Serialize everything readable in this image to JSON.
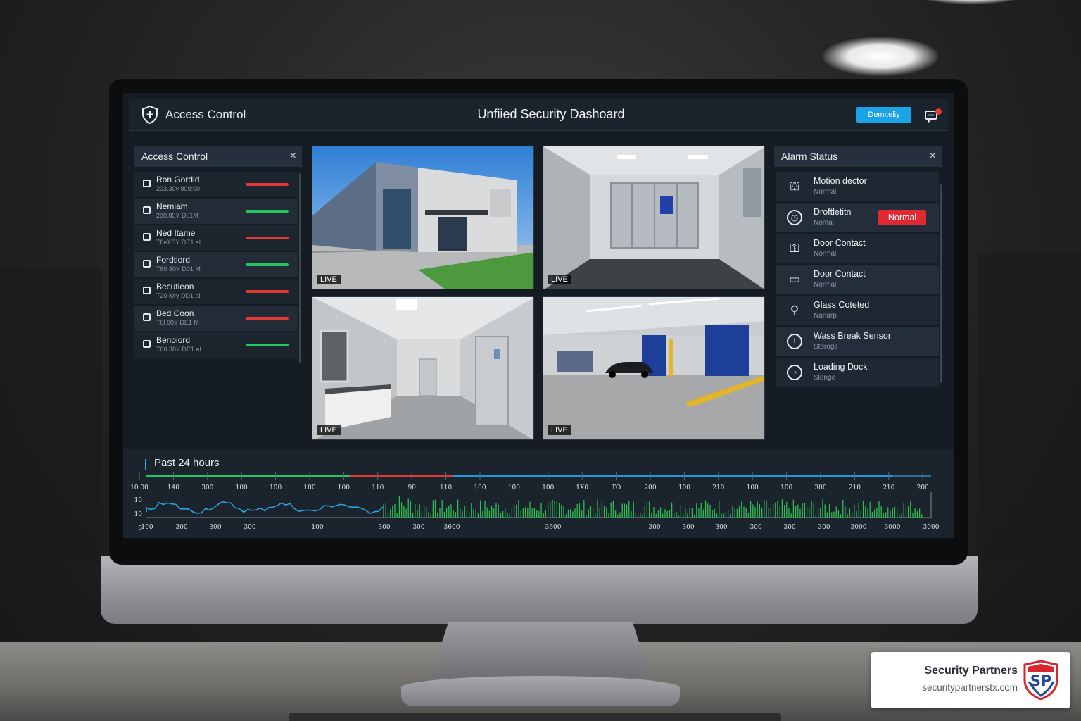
{
  "header": {
    "app_title": "Access Control",
    "dashboard_title": "Unfiied Security Dashoard",
    "button_label": "Demiteliy"
  },
  "access_panel": {
    "title": "Access Control",
    "close": "×",
    "items": [
      {
        "name": "Ron Gordid",
        "sub": "203.30y 800:00",
        "status_color": "#e53935"
      },
      {
        "name": "Nemiam",
        "sub": "280.85Y D01M",
        "status_color": "#22c55e"
      },
      {
        "name": "Ned Itame",
        "sub": "T8eXSY DE1 al",
        "status_color": "#e53935"
      },
      {
        "name": "Fordtiord",
        "sub": "T80 80Y D01 M",
        "status_color": "#22c55e"
      },
      {
        "name": "Becutieon",
        "sub": "T20 l0ry DD1 al",
        "status_color": "#e53935"
      },
      {
        "name": "Bed Coon",
        "sub": "T0l 80Y DE1 M",
        "status_color": "#e53935"
      },
      {
        "name": "Benoiord",
        "sub": "T00.38Y DE1 al",
        "status_color": "#22c55e"
      }
    ]
  },
  "cameras": [
    {
      "label": "LIVE",
      "scene": "building-exterior"
    },
    {
      "label": "LIVE",
      "scene": "corridor-entrance"
    },
    {
      "label": "LIVE",
      "scene": "hallway"
    },
    {
      "label": "LIVE",
      "scene": "loading-dock"
    }
  ],
  "alarm_panel": {
    "title": "Alarm Status",
    "close": "×",
    "items": [
      {
        "name": "Motion dector",
        "sub": "Normal",
        "icon": "motion-sensor-icon",
        "glyph": "⛫"
      },
      {
        "name": "Droftletitn",
        "sub": "Nomal",
        "icon": "clock-icon",
        "glyph": "◷",
        "badge": "Normal"
      },
      {
        "name": "Door Contact",
        "sub": "Normal",
        "icon": "door-contact-icon",
        "glyph": "⚿"
      },
      {
        "name": "Door Contact",
        "sub": "Normal",
        "icon": "monitor-icon",
        "glyph": "▭"
      },
      {
        "name": "Glass Coteted",
        "sub": "Nanarp",
        "icon": "glass-break-icon",
        "glyph": "⚲"
      },
      {
        "name": "Wass Break Sensor",
        "sub": "Storogs",
        "icon": "alert-circle-icon",
        "glyph": "!"
      },
      {
        "name": "Loading Dock",
        "sub": "Slonge",
        "icon": "clock-icon",
        "glyph": "◔"
      }
    ],
    "colors": {
      "badge": "#e02a33"
    }
  },
  "timeline": {
    "title": "Past 24 hours",
    "y_labels": [
      "10",
      "10",
      "0"
    ],
    "top_ticks": [
      "10 00",
      "140",
      "300",
      "100",
      "100",
      "100",
      "100",
      "110",
      "90",
      "110",
      "100",
      "100",
      "100",
      "1X0",
      "TO",
      "200",
      "100",
      "210",
      "100",
      "100",
      "300",
      "210",
      "210",
      "200"
    ],
    "bottom_ticks": [
      "100",
      "300",
      "300",
      "300",
      "100",
      "300",
      "300",
      "3600",
      "3600",
      "300",
      "300",
      "300",
      "300",
      "300",
      "300",
      "3000",
      "3000",
      "3000"
    ],
    "status_segments": [
      {
        "from": 0.0,
        "to": 0.26,
        "color": "#22c55e"
      },
      {
        "from": 0.26,
        "to": 0.39,
        "color": "#e53935"
      },
      {
        "from": 0.39,
        "to": 0.95,
        "color": "#1e9be0"
      },
      {
        "from": 0.95,
        "to": 1.0,
        "color": "#2f6f95"
      }
    ]
  },
  "brand": {
    "name": "Security Partners",
    "url": "securitypartnerstx.com",
    "mark_text": "SP"
  }
}
